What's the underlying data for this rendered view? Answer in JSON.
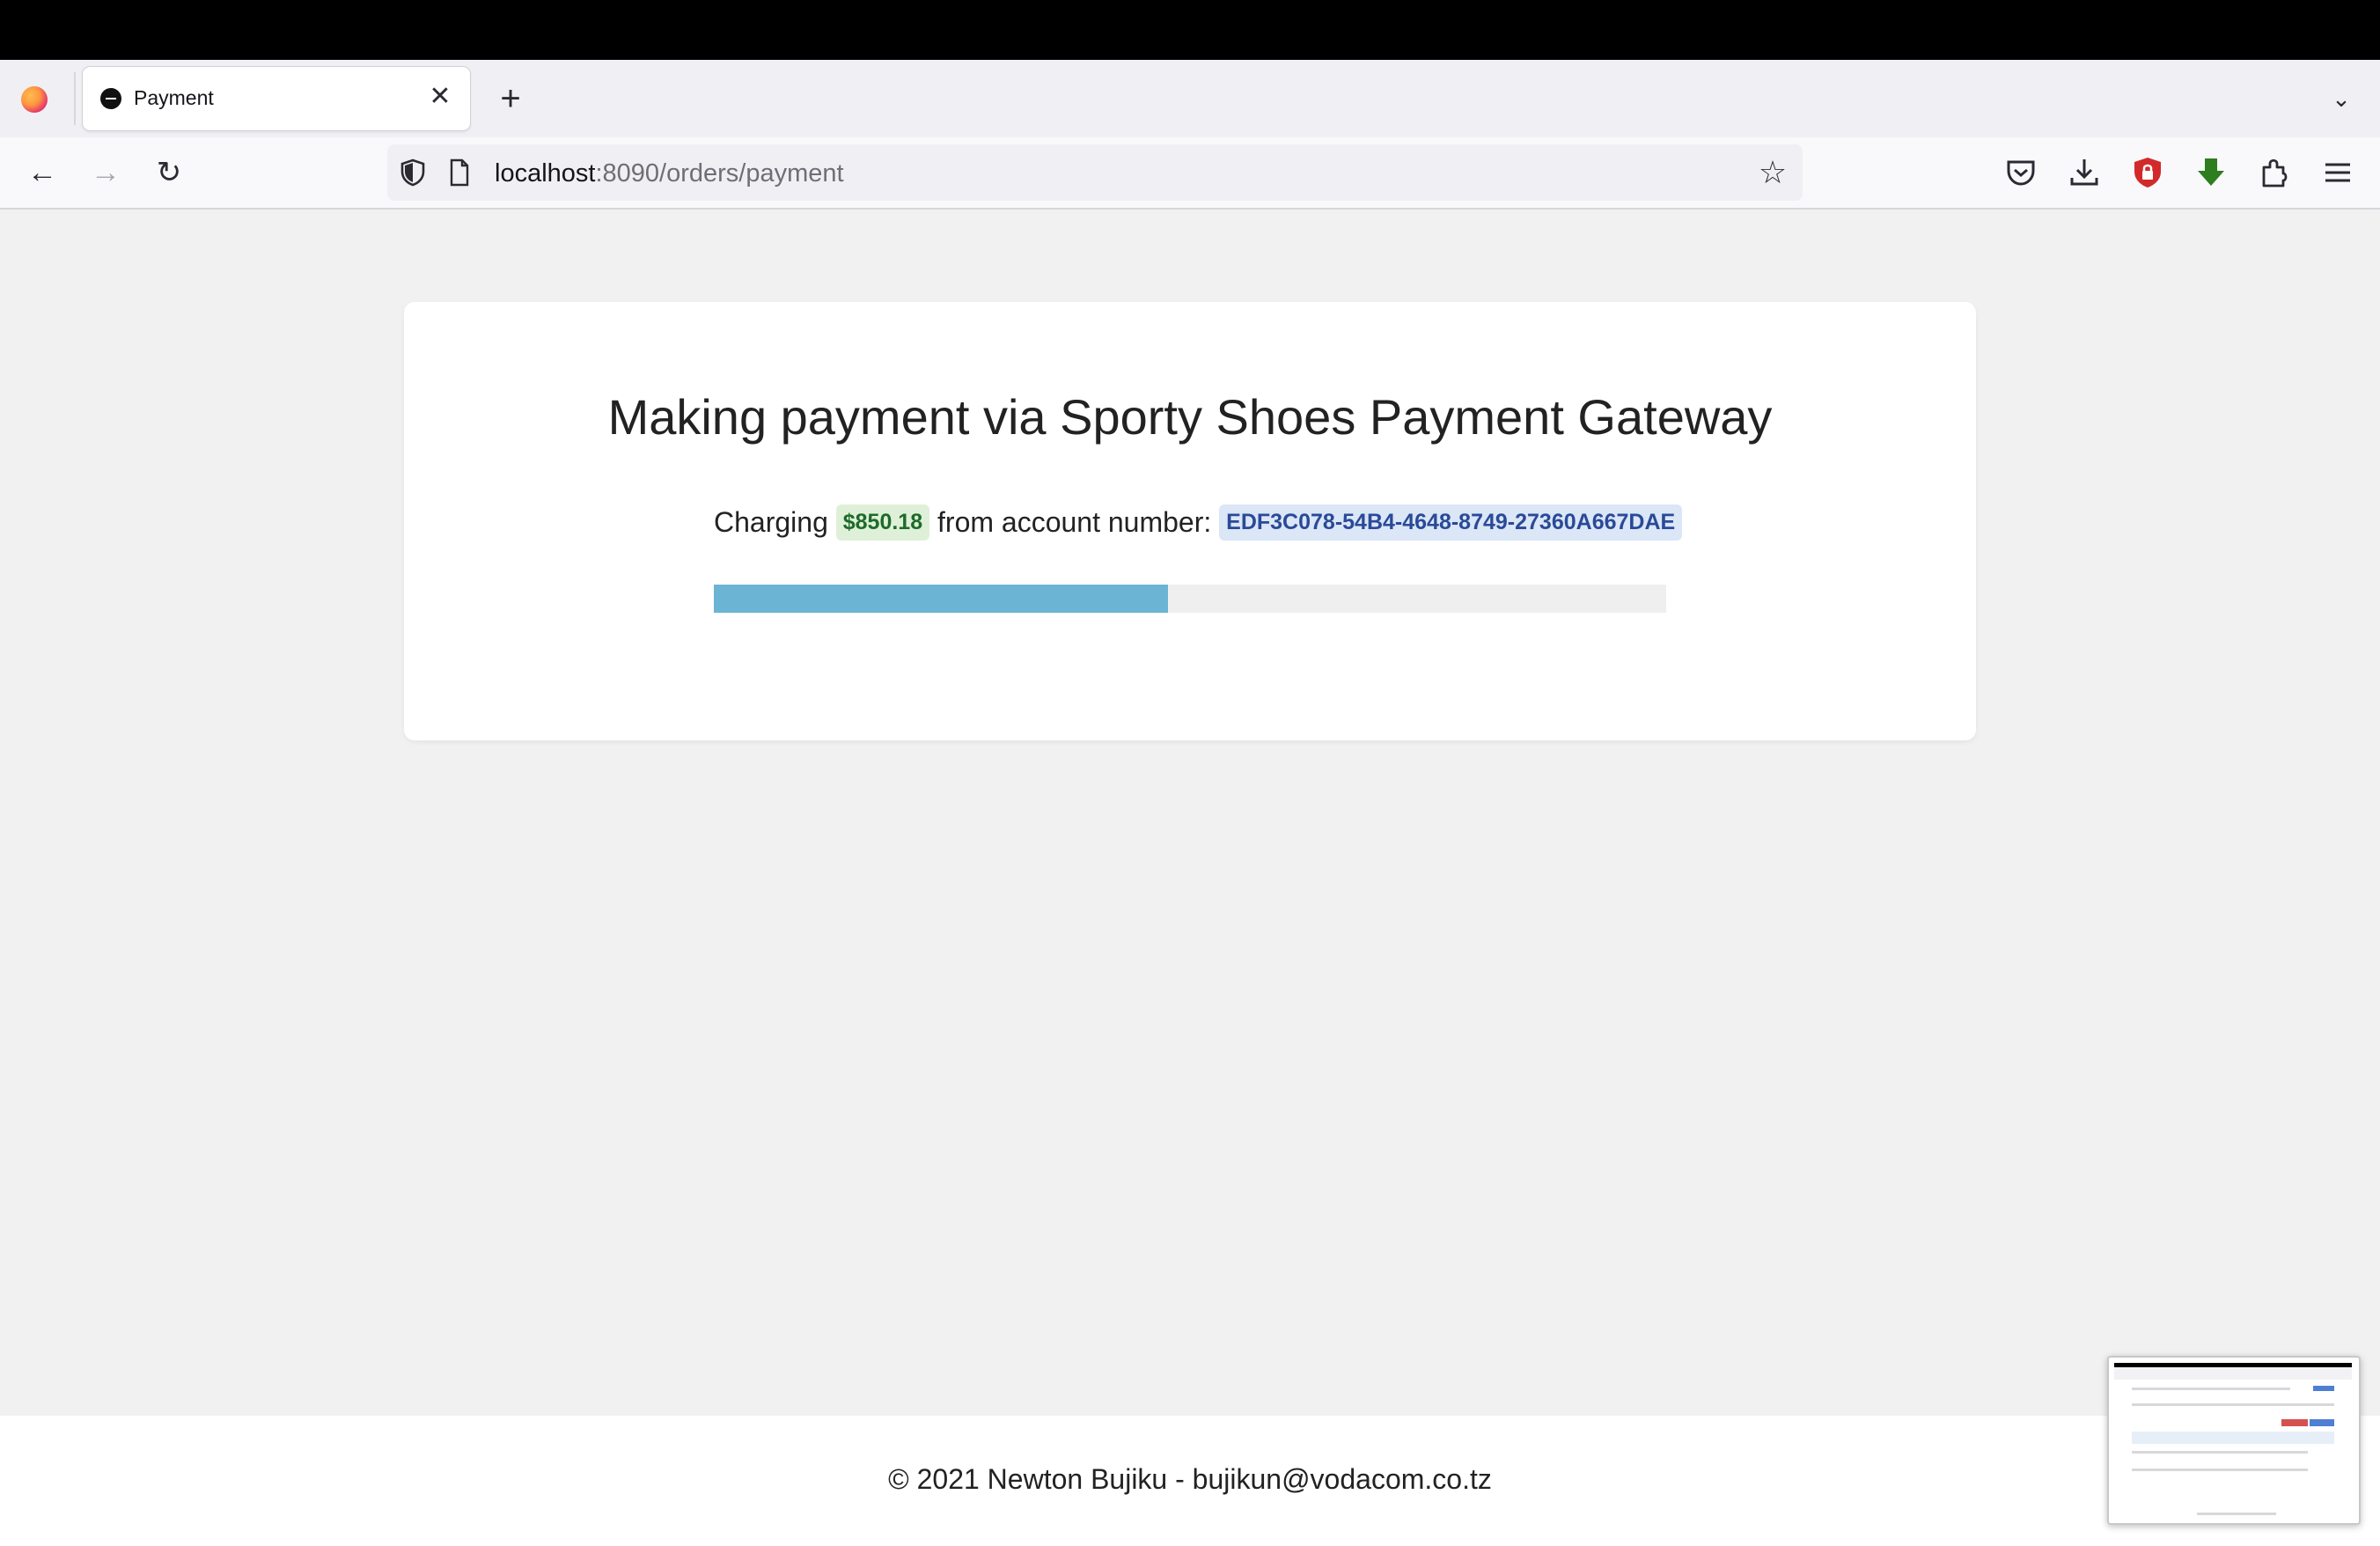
{
  "browser": {
    "tab": {
      "title": "Payment",
      "close_symbol": "✕"
    },
    "new_tab_symbol": "+",
    "tab_list_symbol": "⌄",
    "nav": {
      "back_symbol": "←",
      "forward_symbol": "→",
      "reload_symbol": "↻"
    },
    "url": {
      "host": "localhost",
      "rest": ":8090/orders/payment"
    },
    "bookmark_symbol": "☆",
    "toolbar_icons": [
      "pocket-icon",
      "downloads-icon",
      "ublock-shield-icon",
      "green-download-extension-icon",
      "extensions-icon",
      "menu-icon"
    ],
    "colors": {
      "ublock_red": "#d22a2a",
      "extension_green": "#2e7d1e"
    }
  },
  "page": {
    "title": "Making payment via Sporty Shoes Payment Gateway",
    "charge": {
      "prefix": "Charging",
      "amount": "$850.18",
      "middle": "from account number:",
      "account_number": "EDF3C078-54B4-4648-8749-27360A667DAE"
    },
    "progress_fraction": 0.477,
    "colors": {
      "progress": "#6cb4d4",
      "amount_badge": "#dff0d8",
      "account_badge": "#dbe6f6"
    }
  },
  "footer": {
    "text": "© 2021 Newton Bujiku - bujikun@vodacom.co.tz"
  }
}
